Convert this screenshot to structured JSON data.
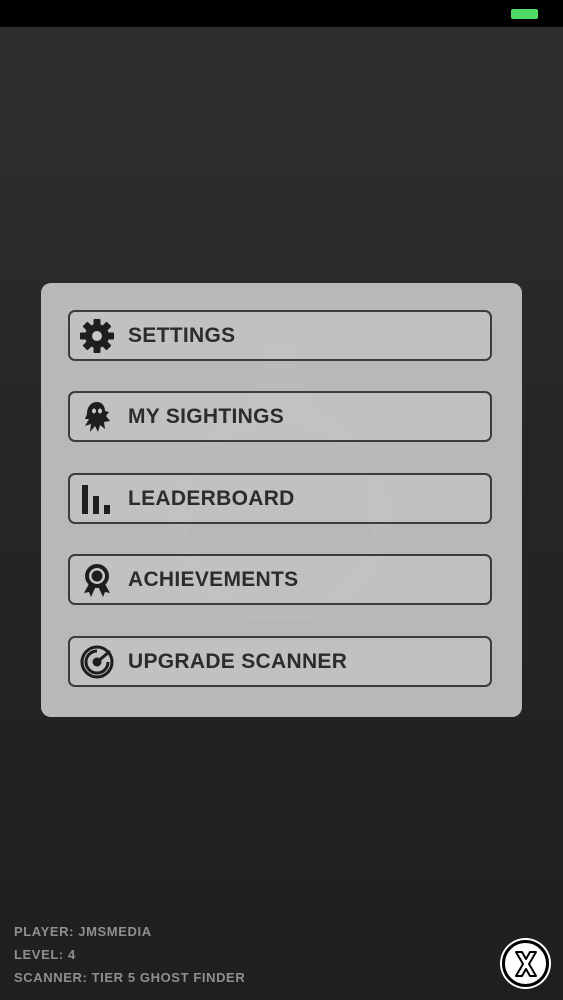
{
  "menu": {
    "items": [
      {
        "label": "SETTINGS",
        "icon": "gear-icon"
      },
      {
        "label": "MY SIGHTINGS",
        "icon": "ghost-icon"
      },
      {
        "label": "LEADERBOARD",
        "icon": "bar-chart-icon"
      },
      {
        "label": "ACHIEVEMENTS",
        "icon": "award-ribbon-icon"
      },
      {
        "label": "UPGRADE SCANNER",
        "icon": "radar-icon"
      }
    ]
  },
  "player": {
    "name_line": "PLAYER: JMSMEDIA",
    "level_line": "LEVEL: 4",
    "scanner_line": "SCANNER: TIER 5 GHOST FINDER"
  },
  "close_button": {
    "icon": "close-x-icon"
  },
  "colors": {
    "battery": "#4cd964",
    "panel": "#c4c4c4",
    "button_border": "#3c3c3c",
    "label_text": "#2c2c2c",
    "info_text": "#8f8f8f"
  }
}
